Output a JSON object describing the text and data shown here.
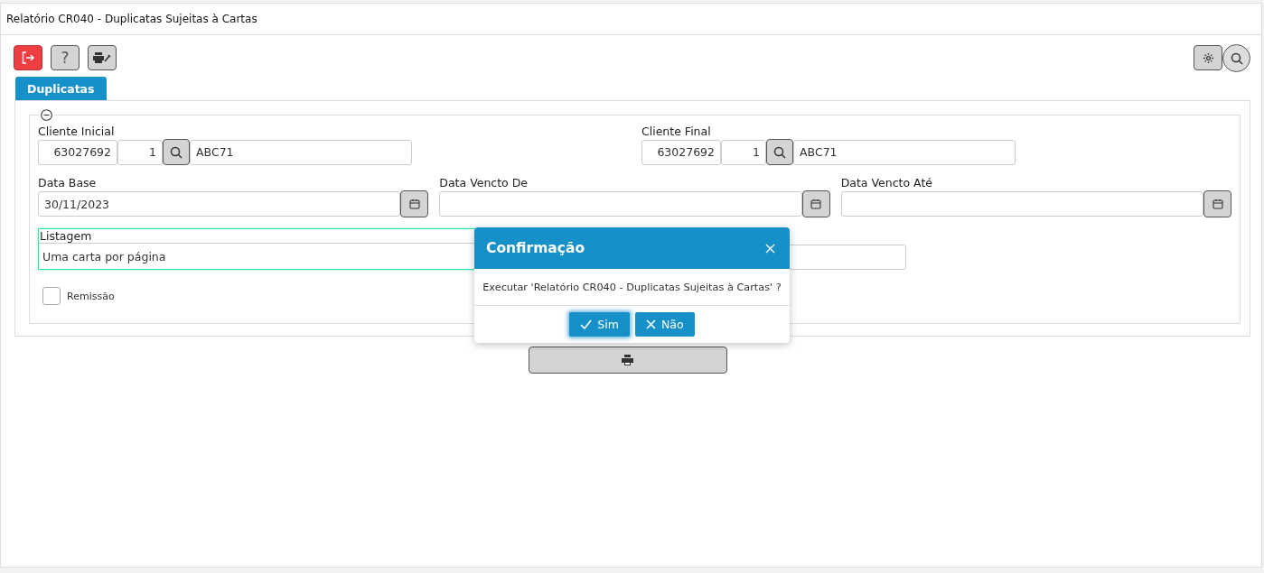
{
  "window": {
    "title": "Relatório CR040 - Duplicatas Sujeitas à Cartas"
  },
  "toolbar": {
    "left": [
      {
        "kind": "exit"
      },
      {
        "kind": "help",
        "glyph": "?"
      },
      {
        "kind": "printer-settings"
      }
    ],
    "right": [
      {
        "kind": "settings"
      },
      {
        "kind": "search"
      }
    ]
  },
  "tabs": [
    {
      "label": "Duplicatas",
      "selected": true
    }
  ],
  "clients": [
    {
      "label": "Cliente Inicial",
      "code": "63027692",
      "branch": "1",
      "name": "ABC71"
    },
    {
      "label": "Cliente Final",
      "code": "63027692",
      "branch": "1",
      "name": "ABC71"
    }
  ],
  "dates": [
    {
      "label": "Data Base",
      "value": "30/11/2023"
    },
    {
      "label": "Data Vencto De"
    },
    {
      "label": "Data Vencto Até"
    }
  ],
  "listagem": {
    "label": "Listagem",
    "value": "Uma carta por página",
    "focused": true
  },
  "remissao": {
    "label": "Remissão",
    "checked": false
  },
  "dialog": {
    "title": "Confirmação",
    "message": "Executar 'Relatório CR040 - Duplicatas Sujeitas à Cartas' ?",
    "buttons": [
      {
        "kind": "confirm",
        "label": "Sim",
        "focused": true
      },
      {
        "kind": "cancel",
        "label": "Não",
        "focused": false
      }
    ]
  }
}
